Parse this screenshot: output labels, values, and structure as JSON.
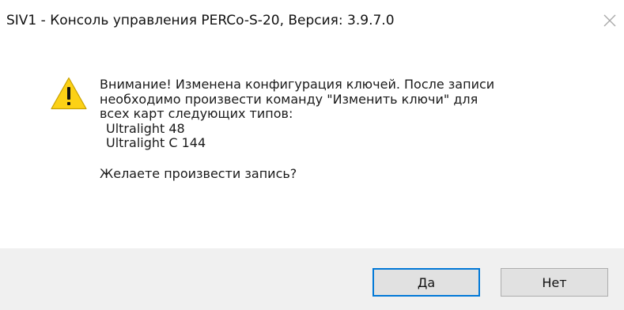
{
  "window": {
    "title": "SIV1 - Консоль управления PERCo-S-20, Версия: 3.9.7.0",
    "close_icon": "close-icon"
  },
  "message": {
    "icon": "warning-icon",
    "lines": [
      "Внимание! Изменена конфигурация ключей. После записи",
      "необходимо произвести команду \"Изменить ключи\" для",
      "всех карт следующих типов:"
    ],
    "card_types": [
      "Ultralight 48",
      "Ultralight C 144"
    ],
    "question": "Желаете произвести запись?"
  },
  "buttons": {
    "yes_label": "Да",
    "no_label": "Нет"
  },
  "colors": {
    "footer_bg": "#f0f0f0",
    "default_button_border": "#0078d7",
    "warning_fill": "#fcd116"
  }
}
